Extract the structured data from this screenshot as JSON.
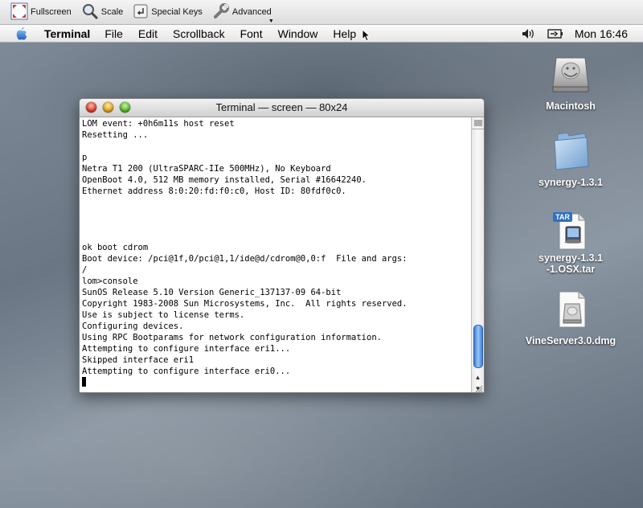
{
  "vnc_toolbar": {
    "fullscreen_label": "Fullscreen",
    "scale_label": "Scale",
    "special_keys_label": "Special Keys",
    "advanced_label": "Advanced"
  },
  "menubar": {
    "app_name": "Terminal",
    "items": [
      "File",
      "Edit",
      "Scrollback",
      "Font",
      "Window",
      "Help"
    ],
    "clock": "Mon 16:46"
  },
  "terminal": {
    "title": "Terminal — screen — 80x24",
    "lines": [
      "LOM event: +0h6m11s host reset",
      "Resetting ...",
      "",
      "p",
      "Netra T1 200 (UltraSPARC-IIe 500MHz), No Keyboard",
      "OpenBoot 4.0, 512 MB memory installed, Serial #16642240.",
      "Ethernet address 8:0:20:fd:f0:c0, Host ID: 80fdf0c0.",
      "",
      "",
      "",
      "",
      "ok boot cdrom",
      "Boot device: /pci@1f,0/pci@1,1/ide@d/cdrom@0,0:f  File and args:",
      "/",
      "lom>console",
      "SunOS Release 5.10 Version Generic_137137-09 64-bit",
      "Copyright 1983-2008 Sun Microsystems, Inc.  All rights reserved.",
      "Use is subject to license terms.",
      "Configuring devices.",
      "Using RPC Bootparams for network configuration information.",
      "Attempting to configure interface eri1...",
      "Skipped interface eri1",
      "Attempting to configure interface eri0...",
      ""
    ]
  },
  "desktop_icons": {
    "macintosh": "Macintosh",
    "synergy_folder": "synergy-1.3.1",
    "synergy_tar": "synergy-1.3.1\n-1.OSX.tar",
    "tar_badge": "TAR",
    "vineserver": "VineServer3.0.dmg"
  }
}
